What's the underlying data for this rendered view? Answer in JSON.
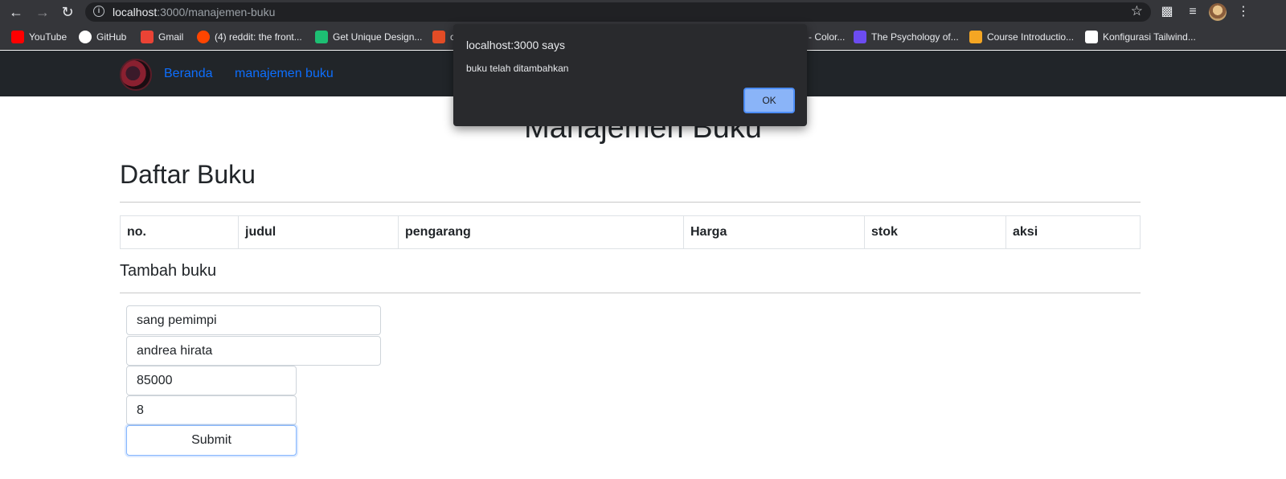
{
  "browser": {
    "url_host": "localhost",
    "url_rest": ":3000/manajemen-buku",
    "bookmarks": [
      {
        "label": "YouTube",
        "color": "#ff0000"
      },
      {
        "label": "GitHub",
        "color": "#ffffff"
      },
      {
        "label": "Gmail",
        "color": "#ea4335"
      },
      {
        "label": "(4) reddit: the front...",
        "color": "#ff4500"
      },
      {
        "label": "Get Unique Design...",
        "color": "#1dbf73"
      },
      {
        "label": "c",
        "color": "#e34c26"
      },
      {
        "label": "- Color...",
        "color": "#e8eaed"
      },
      {
        "label": "The Psychology of...",
        "color": "#6c4cf1"
      },
      {
        "label": "Course Introductio...",
        "color": "#f5a623"
      },
      {
        "label": "Konfigurasi Tailwind...",
        "color": "#ffffff"
      }
    ]
  },
  "dialog": {
    "title": "localhost:3000 says",
    "message": "buku telah ditambahkan",
    "ok_label": "OK"
  },
  "nav": {
    "links": [
      "Beranda",
      "manajemen buku"
    ],
    "link_color": "#0d6efd"
  },
  "page": {
    "title": "Manajemen Buku",
    "list_heading": "Daftar Buku",
    "table_headers": [
      "no.",
      "judul",
      "pengarang",
      "Harga",
      "stok",
      "aksi"
    ],
    "add_heading": "Tambah buku",
    "form": {
      "judul": "sang pemimpi",
      "pengarang": "andrea hirata",
      "harga": "85000",
      "stok": "8",
      "submit_label": "Submit"
    }
  }
}
